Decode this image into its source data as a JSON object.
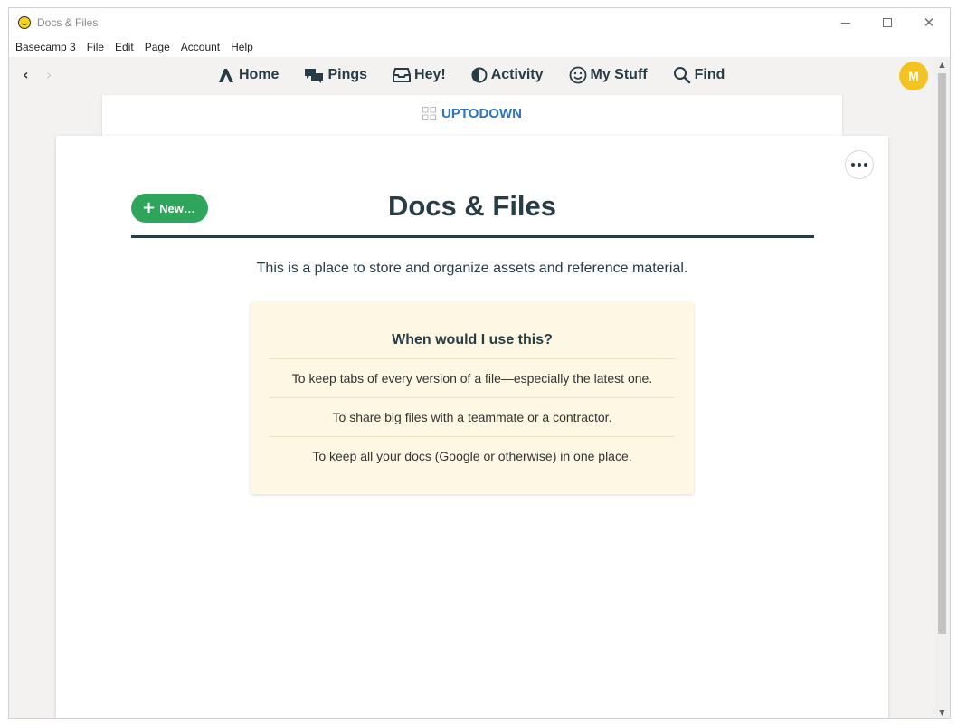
{
  "window": {
    "title": "Docs & Files",
    "close_glyph": "✕"
  },
  "menu": {
    "items": [
      "Basecamp 3",
      "File",
      "Edit",
      "Page",
      "Account",
      "Help"
    ]
  },
  "nav": {
    "back_glyph": "‹",
    "forward_glyph": "›",
    "links": [
      {
        "label": "Home",
        "icon": "home-icon"
      },
      {
        "label": "Pings",
        "icon": "pings-icon"
      },
      {
        "label": "Hey!",
        "icon": "hey-icon"
      },
      {
        "label": "Activity",
        "icon": "activity-icon"
      },
      {
        "label": "My Stuff",
        "icon": "my-stuff-icon"
      },
      {
        "label": "Find",
        "icon": "find-icon"
      }
    ],
    "avatar_initial": "M"
  },
  "project": {
    "name": "UPTODOWN"
  },
  "page": {
    "new_button_label": "New…",
    "title": "Docs & Files",
    "description": "This is a place to store and organize assets and reference material."
  },
  "help": {
    "title": "When would I use this?",
    "items": [
      "To keep tabs of every version of a file—especially the latest one.",
      "To share big files with a teammate or a contractor.",
      "To keep all your docs (Google or otherwise) in one place."
    ]
  },
  "colors": {
    "accent_green": "#2fa55c",
    "avatar_yellow": "#f3c321",
    "link_blue": "#2c73c2",
    "help_bg": "#fdf7e3",
    "text_dark": "#283c46"
  }
}
